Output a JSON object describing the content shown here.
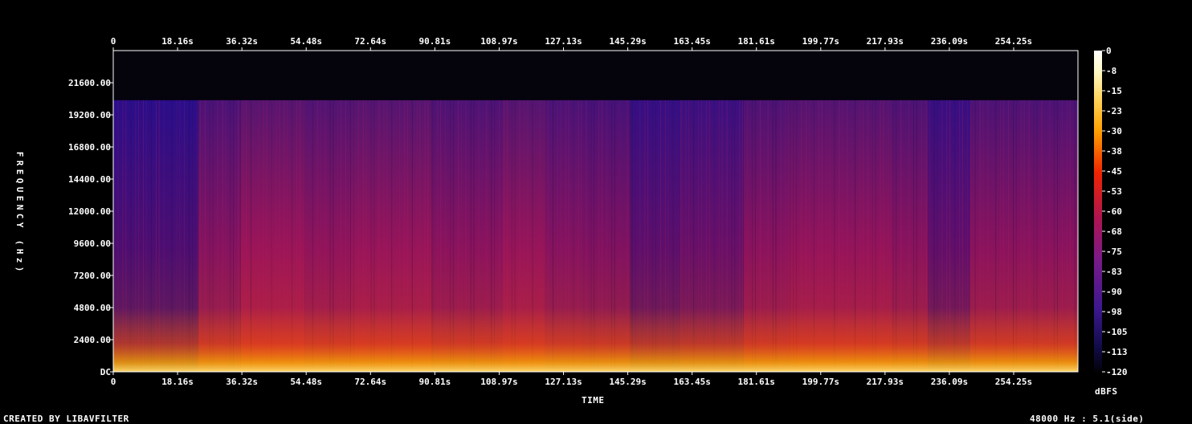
{
  "chart_data": {
    "type": "heatmap",
    "xlabel": "TIME",
    "ylabel": "FREQUENCY (Hz)",
    "x_ticks": [
      "0",
      "18.16s",
      "36.32s",
      "54.48s",
      "72.64s",
      "90.81s",
      "108.97s",
      "127.13s",
      "145.29s",
      "163.45s",
      "181.61s",
      "199.77s",
      "217.93s",
      "236.09s",
      "254.25s"
    ],
    "x_tick_values": [
      0,
      18.16,
      36.32,
      54.48,
      72.64,
      90.81,
      108.97,
      127.13,
      145.29,
      163.45,
      181.61,
      199.77,
      217.93,
      236.09,
      254.25
    ],
    "x_range": [
      0,
      272.4
    ],
    "y_ticks": [
      "DC",
      "2400.00",
      "4800.00",
      "7200.00",
      "9600.00",
      "12000.00",
      "14400.00",
      "16800.00",
      "19200.00",
      "21600.00"
    ],
    "y_tick_values": [
      0,
      2400,
      4800,
      7200,
      9600,
      12000,
      14400,
      16800,
      19200,
      21600
    ],
    "y_range": [
      0,
      24000
    ],
    "colorbar": {
      "label": "dBFS",
      "ticks": [
        "0",
        "-8",
        "-15",
        "-23",
        "-30",
        "-38",
        "-45",
        "-53",
        "-60",
        "-68",
        "-75",
        "-83",
        "-90",
        "-98",
        "-105",
        "-113",
        "-120"
      ],
      "range": [
        -120,
        0
      ]
    },
    "spectrum_cutoff_hz": 20300,
    "segments": [
      {
        "start": 0,
        "end": 24,
        "level": 0.22
      },
      {
        "start": 24,
        "end": 36,
        "level": 0.55
      },
      {
        "start": 36,
        "end": 54,
        "level": 0.68
      },
      {
        "start": 54,
        "end": 67,
        "level": 0.62
      },
      {
        "start": 67,
        "end": 90,
        "level": 0.66
      },
      {
        "start": 90,
        "end": 110,
        "level": 0.58
      },
      {
        "start": 110,
        "end": 122,
        "level": 0.66
      },
      {
        "start": 122,
        "end": 132,
        "level": 0.55
      },
      {
        "start": 132,
        "end": 146,
        "level": 0.52
      },
      {
        "start": 146,
        "end": 160,
        "level": 0.32
      },
      {
        "start": 160,
        "end": 178,
        "level": 0.38
      },
      {
        "start": 178,
        "end": 191,
        "level": 0.58
      },
      {
        "start": 191,
        "end": 220,
        "level": 0.64
      },
      {
        "start": 220,
        "end": 230,
        "level": 0.58
      },
      {
        "start": 230,
        "end": 242,
        "level": 0.34
      },
      {
        "start": 242,
        "end": 272.4,
        "level": 0.58
      }
    ]
  },
  "footer": {
    "left": "CREATED BY LIBAVFILTER",
    "right": "48000 Hz : 5.1(side)"
  },
  "colors": {
    "background": "#000000",
    "frame": "#ffffff",
    "text": "#ffffff"
  }
}
